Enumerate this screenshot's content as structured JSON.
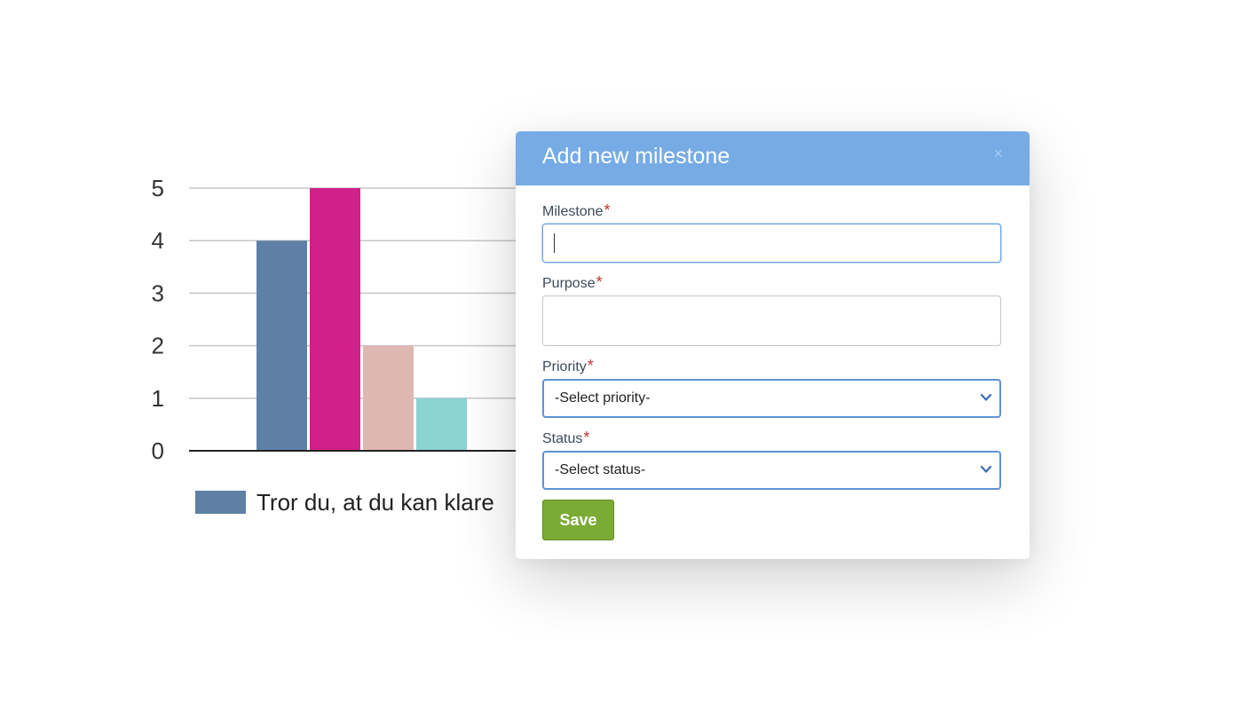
{
  "chart_data": {
    "type": "bar",
    "categories": [
      "",
      "",
      "",
      ""
    ],
    "series": [
      {
        "name": "Tror du, at du kan klare",
        "values": [
          4
        ]
      },
      {
        "values": [
          5
        ]
      },
      {
        "values": [
          2
        ]
      },
      {
        "values": [
          1
        ]
      }
    ],
    "values": [
      4,
      5,
      2,
      1
    ],
    "colors": [
      "#5f80a6",
      "#d0208a",
      "#dfb7b2",
      "#8dd3d3"
    ],
    "yticks": [
      "0",
      "1",
      "2",
      "3",
      "4",
      "5"
    ],
    "ylim": [
      0,
      5
    ],
    "grid": true,
    "legend_position": "bottom",
    "title": "",
    "xlabel": "",
    "ylabel": ""
  },
  "legend": {
    "label": "Tror du, at du kan klare",
    "color": "#5f80a6"
  },
  "modal": {
    "title": "Add new milestone",
    "close_icon": "×",
    "header_color": "#76abe5",
    "milestone_label": "Milestone",
    "purpose_label": "Purpose",
    "priority_label": "Priority",
    "status_label": "Status",
    "required_mark": "*",
    "milestone_value": "",
    "purpose_value": "",
    "priority_value": "-Select priority-",
    "status_value": "-Select status-",
    "save_label": "Save",
    "save_color": "#7cab35"
  }
}
